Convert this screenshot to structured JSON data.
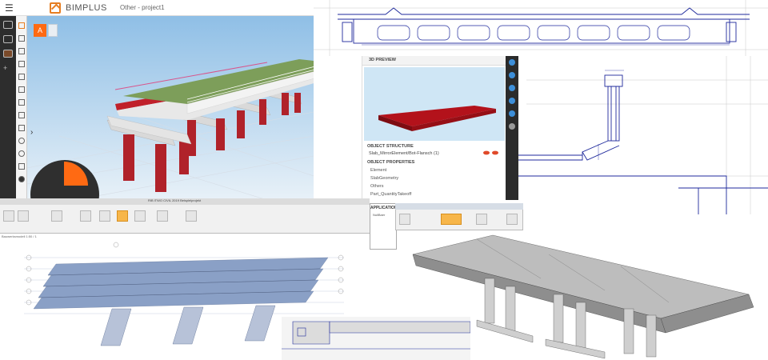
{
  "bimplus": {
    "menu_icon": "hamburger-icon",
    "brand": "BIMPLUS",
    "project": "Other - project1",
    "view_button": "A",
    "accent_color": "#ff6a13"
  },
  "preview": {
    "title": "3D PREVIEW",
    "structure_label": "OBJECT STRUCTURE",
    "structure_value": "Slab_MirrorElement/Bot-Flansch (1)",
    "properties_label": "OBJECT PROPERTIES",
    "properties": [
      "Element",
      "SlabGeometry",
      "Others",
      "Part_QuantityTakeoff"
    ]
  },
  "ribbon_left": {
    "title": "RIB iTWO CIVIL 2019 Beispielprojekt"
  },
  "application": {
    "label": "APPLICATION",
    "sub": "NullBaer"
  },
  "grid_drawing": {
    "caption": "Bauwerksmodell 1:50 / 1"
  },
  "colors": {
    "pier": "#b0222a",
    "deck": "#7d9e5a",
    "cad_line": "#1f2a9c"
  }
}
